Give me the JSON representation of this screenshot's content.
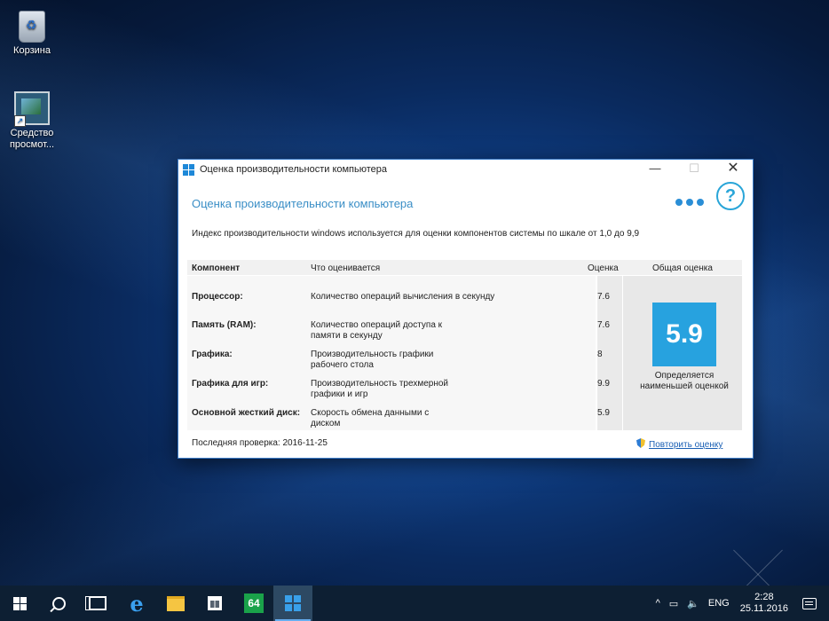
{
  "desktop": {
    "icons": [
      {
        "label": "Корзина",
        "icon": "recycle-bin-icon"
      },
      {
        "label": "Средство просмот...",
        "icon": "photo-viewer-icon"
      }
    ]
  },
  "window": {
    "title": "Оценка производительности компьютера",
    "heading": "Оценка производительности компьютера",
    "description": "Индекс производительности windows используется для оценки компонентов системы по шкале от 1,0 до 9,9",
    "columns": {
      "component": "Компонент",
      "what": "Что оценивается",
      "score": "Оценка",
      "total": "Общая оценка"
    },
    "rows": [
      {
        "component": "Процессор:",
        "what": "Количество операций вычисления в секунду",
        "score": "7.6"
      },
      {
        "component": "Память (RAM):",
        "what": "Количество операций доступа к памяти в секунду",
        "score": "7.6"
      },
      {
        "component": "Графика:",
        "what": "Производительность графики рабочего стола",
        "score": "8"
      },
      {
        "component": "Графика для игр:",
        "what": "Производительность трехмерной графики и игр",
        "score": "9.9"
      },
      {
        "component": "Основной жесткий диск:",
        "what": "Скорость обмена данными с диском",
        "score": "5.9"
      }
    ],
    "total_score": "5.9",
    "total_caption": "Определяется наименьшей оценкой",
    "last_check": "Последняя проверка: 2016-11-25",
    "rerun_link": "Повторить оценку",
    "accent_color": "#27a2df"
  },
  "taskbar": {
    "pinned": [
      "start-icon",
      "search-icon",
      "task-view-icon",
      "edge-icon",
      "file-explorer-icon",
      "store-icon",
      "app-64-icon",
      "winsat-app-icon"
    ],
    "app_64_label": "64",
    "tray_chevron": "^",
    "language": "ENG",
    "time": "2:28",
    "date": "25.11.2016"
  }
}
